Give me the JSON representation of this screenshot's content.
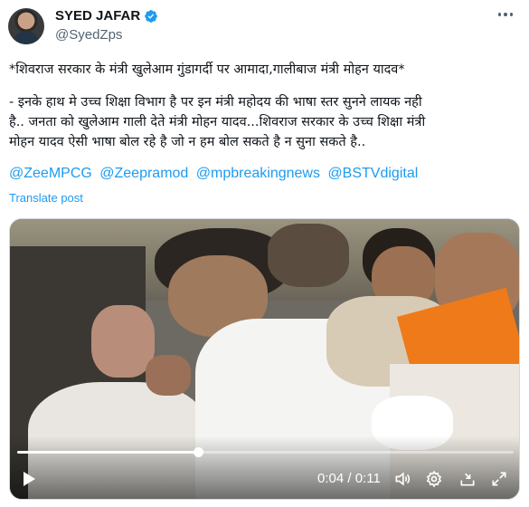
{
  "user": {
    "name": "SYED JAFAR",
    "handle": "@SyedZps",
    "verified_color": "#1d9bf0"
  },
  "tweet": {
    "line1": "*शिवराज सरकार के मंत्री खुलेआम गुंडागर्दी पर आमादा,गालीबाज मंत्री मोहन यादव*",
    "line2": "- इनके हाथ मे उच्च शिक्षा विभाग है पर इन मंत्री महोदय की भाषा स्तर सुनने लायक  नही",
    "line3": "है.. जनता को खुलेआम गाली देते मंत्री मोहन यादव...शिवराज सरकार के उच्च शिक्षा मंत्री",
    "line4": "मोहन यादव ऐसी भाषा बोल रहे है जो न हम बोल सकते है न सुना सकते है..",
    "mentions": [
      "@ZeeMPCG",
      "@Zeepramod",
      "@mpbreakingnews",
      "@BSTVdigital"
    ],
    "translate_label": "Translate post"
  },
  "video": {
    "current_time": "0:04",
    "separator": " / ",
    "duration": "0:11",
    "progress_fraction": 0.364,
    "icons": [
      "play-icon",
      "volume-icon",
      "settings-gear-icon",
      "exit-embed-icon",
      "fullscreen-icon"
    ]
  },
  "colors": {
    "accent": "#1d9bf0",
    "text": "#0f1419",
    "muted": "#536471"
  }
}
